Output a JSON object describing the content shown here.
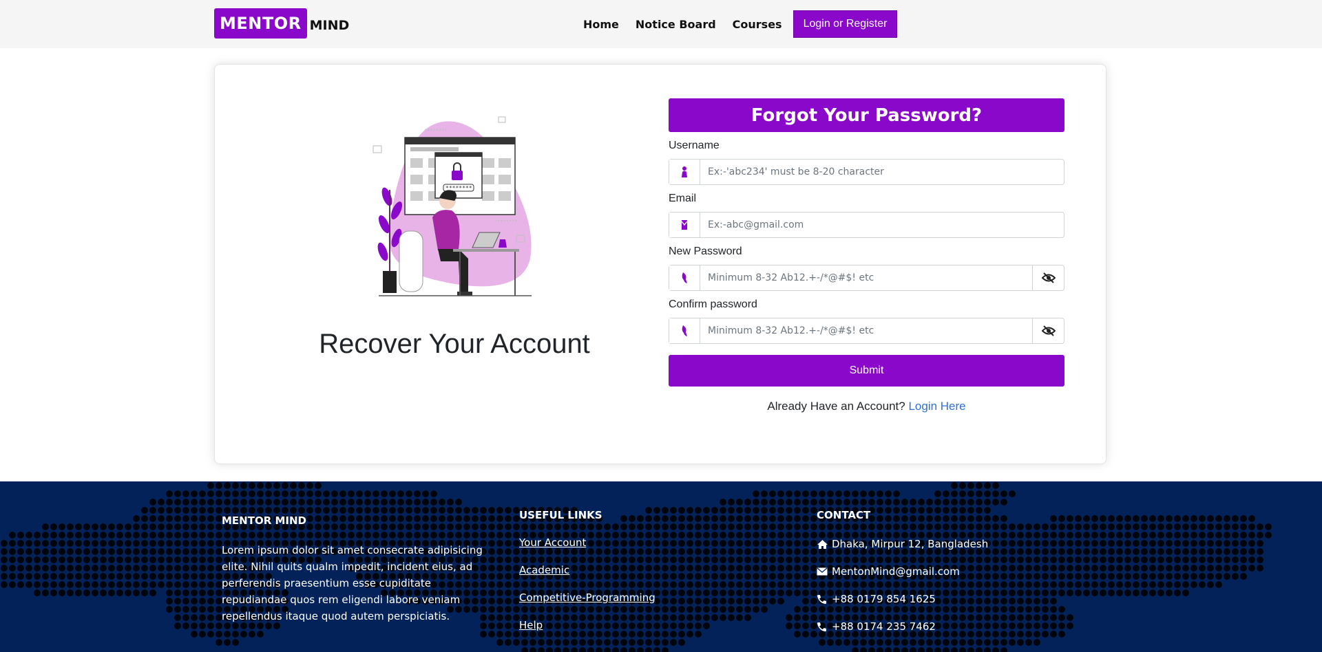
{
  "navbar": {
    "brand_box": "MENTOR",
    "brand_text": "MIND",
    "links": [
      "Home",
      "Notice Board",
      "Courses"
    ],
    "cta": "Login or Register"
  },
  "card": {
    "recover_title": "Recover Your Account",
    "form": {
      "title": "Forgot Your Password?",
      "username_label": "Username",
      "username_placeholder": "Ex:-'abc234' must be 8-20 character",
      "email_label": "Email",
      "email_placeholder": "Ex:-abc@gmail.com",
      "new_password_label": "New Password",
      "new_password_placeholder": "Minimum 8-32 Ab12.+-/*@#$! etc",
      "confirm_password_label": "Confirm password",
      "confirm_password_placeholder": "Minimum 8-32 Ab12.+-/*@#$! etc",
      "submit": "Submit",
      "already_text": "Already Have an Account?",
      "login_link": "Login Here"
    }
  },
  "footer": {
    "about": {
      "heading": "MENTOR MIND",
      "text": "Lorem ipsum dolor sit amet consecrate adipisicing elite. Nihil quits qualm impedit, incident eius, ad perferendis praesentium esse cupiditate repudiandae quos rem eligendi labore veniam repellendus itaque quod autem perspiciatis."
    },
    "links": {
      "heading": "USEFUL LINKS",
      "items": [
        "Your Account",
        "Academic",
        "Competitive-Programming",
        "Help"
      ]
    },
    "contact": {
      "heading": "CONTACT",
      "address": "Dhaka, Mirpur 12, Bangladesh",
      "email": "MentonMind@gmail.com",
      "phone1": "+88 0179 854 1625",
      "phone2": "+88 0174 235 7462"
    }
  },
  "colors": {
    "primary": "#8a08c9",
    "footer_bg": "#03225a",
    "link": "#2f6fd8"
  },
  "icons": {
    "username": "user-icon",
    "email": "envelope-icon",
    "password": "key-icon",
    "toggle": "eye-slash-icon",
    "address": "home-icon",
    "mail": "envelope-icon",
    "phone": "phone-icon"
  }
}
